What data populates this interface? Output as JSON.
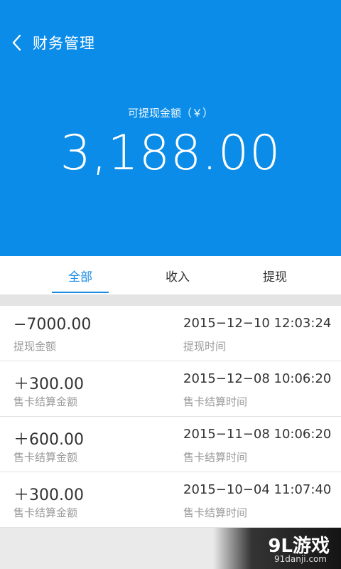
{
  "header": {
    "title": "财务管理",
    "back_icon": "chevron-left-icon",
    "balance_label": "可提现金额（￥）",
    "balance_value": "3,188.00",
    "bg_color": "#0a8ce8"
  },
  "tabs": [
    {
      "label": "全部",
      "active": true
    },
    {
      "label": "收入",
      "active": false
    },
    {
      "label": "提现",
      "active": false
    }
  ],
  "records": [
    {
      "amount": "−7000.00",
      "amount_label": "提现金额",
      "time": "2015−12−10 12:03:24",
      "time_label": "提现时间"
    },
    {
      "amount": "＋300.00",
      "amount_label": "售卡结算金额",
      "time": "2015−12−08 10:06:20",
      "time_label": "售卡结算时间"
    },
    {
      "amount": "＋600.00",
      "amount_label": "售卡结算金额",
      "time": "2015−11−08 10:06:20",
      "time_label": "售卡结算时间"
    },
    {
      "amount": "＋300.00",
      "amount_label": "售卡结算金额",
      "time": "2015−10−04 11:07:40",
      "time_label": "售卡结算时间"
    }
  ],
  "watermark": {
    "logo": "9L游戏",
    "url": "91danji.com"
  },
  "colors": {
    "accent": "#1a8ce6"
  }
}
